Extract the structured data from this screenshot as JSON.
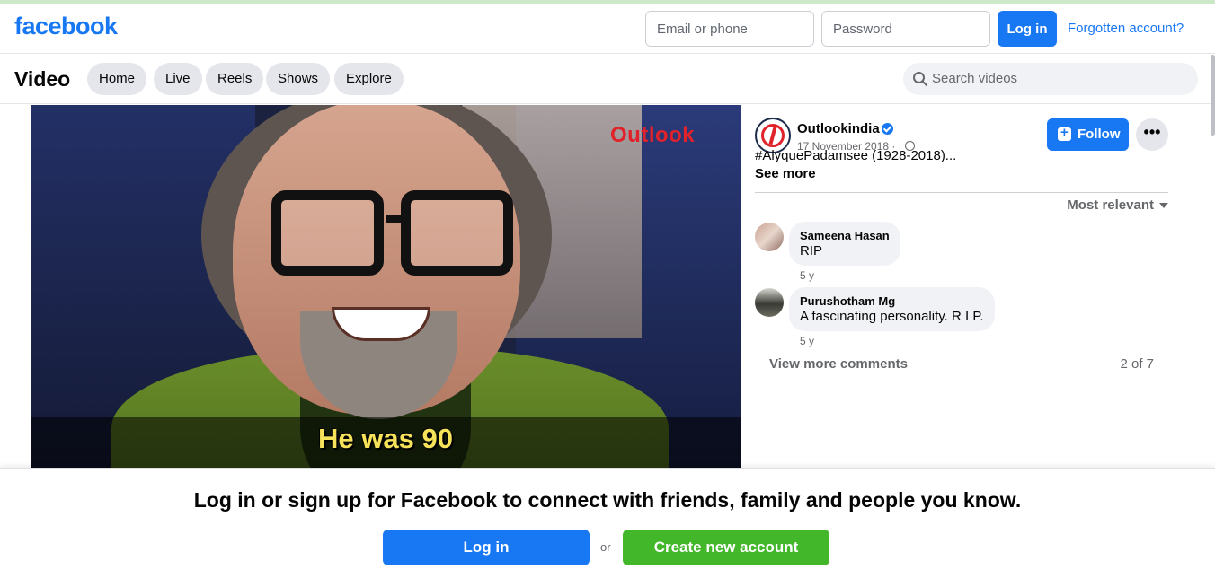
{
  "header": {
    "logo": "facebook",
    "email_placeholder": "Email or phone",
    "password_placeholder": "Password",
    "login_label": "Log in",
    "forgot_label": "Forgotten account?"
  },
  "subnav": {
    "title": "Video",
    "tabs": [
      {
        "label": "Home"
      },
      {
        "label": "Live"
      },
      {
        "label": "Reels"
      },
      {
        "label": "Shows"
      },
      {
        "label": "Explore"
      }
    ],
    "search_placeholder": "Search videos"
  },
  "video": {
    "watermark": "Outlook",
    "caption": "He was 90"
  },
  "post": {
    "page_name": "Outlookindia",
    "date": "17 November 2018 ·",
    "follow_label": "Follow",
    "more_label": "•••",
    "text": "#AlyquePadamsee (1928-2018)...",
    "see_more": "See more",
    "sort_label": "Most relevant"
  },
  "comments": [
    {
      "name": "Sameena Hasan",
      "text": "RIP",
      "time": "5 y"
    },
    {
      "name": "Purushotham Mg",
      "text": "A fascinating personality. R I P.",
      "time": "5 y"
    }
  ],
  "comments_footer": {
    "view_more": "View more comments",
    "count": "2 of 7"
  },
  "banner": {
    "title": "Log in or sign up for Facebook to connect with friends, family and people you know.",
    "login_label": "Log in",
    "or_label": "or",
    "create_label": "Create new account"
  },
  "colors": {
    "brand": "#1877f2",
    "create_green": "#42b72a"
  }
}
